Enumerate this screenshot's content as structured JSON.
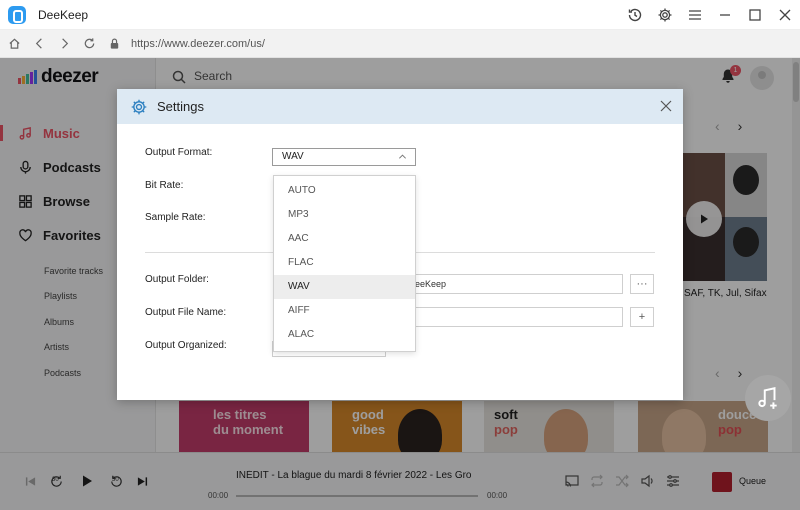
{
  "window": {
    "title": "DeeKeep",
    "url": "https://www.deezer.com/us/"
  },
  "icons": {
    "history": "history-icon",
    "settings": "gear-icon",
    "menu": "hamburger-icon",
    "minimize": "minimize-icon",
    "maximize": "maximize-icon",
    "close": "close-icon"
  },
  "brand": {
    "name": "deezer",
    "bar_colors": [
      "#ef5466",
      "#fdb43b",
      "#44c4a1",
      "#a238ff",
      "#3b83f6"
    ]
  },
  "sidebar": {
    "main": [
      {
        "label": "Music",
        "icon": "music-note-icon",
        "active": true
      },
      {
        "label": "Podcasts",
        "icon": "microphone-icon",
        "active": false
      },
      {
        "label": "Browse",
        "icon": "grid-icon",
        "active": false
      },
      {
        "label": "Favorites",
        "icon": "heart-icon",
        "active": false
      }
    ],
    "sub": [
      "Favorite tracks",
      "Playlists",
      "Albums",
      "Artists",
      "Podcasts"
    ]
  },
  "header": {
    "search_placeholder": "Search",
    "notification_count": "1"
  },
  "content": {
    "artists_caption": "SAF, TK, Jul, Sifax",
    "tiles": [
      {
        "line1": "les titres",
        "line2": "du moment",
        "bg": "#c43c6b",
        "color": "#fde3ea"
      },
      {
        "line1": "good",
        "line2": "vibes",
        "bg": "#d98a2b",
        "color": "#ffffff"
      },
      {
        "line1": "soft",
        "line2": "pop",
        "bg": "#e9e6e0",
        "color": "#222222",
        "accent": "#e0655f"
      },
      {
        "line1": "douce",
        "line2": "pop",
        "bg": "#c9a689",
        "color": "#ffffff",
        "accent": "#e24f55"
      }
    ]
  },
  "player": {
    "track": "INÉDIT - La blague du mardi 8 février 2022 - Les Gro",
    "current_time": "00:00",
    "duration": "00:00",
    "skip_back_label": "30",
    "skip_forward_label": "30",
    "queue_label": "Queue"
  },
  "dialog": {
    "title": "Settings",
    "labels": {
      "output_format": "Output Format:",
      "bit_rate": "Bit Rate:",
      "sample_rate": "Sample Rate:",
      "output_folder": "Output Folder:",
      "output_file_name": "Output File Name:",
      "output_organized": "Output Organized:"
    },
    "output_format_value": "WAV",
    "output_folder_value": "eeKeep",
    "output_file_name_value": "",
    "folder_browse_label": "···",
    "file_name_add_label": "+",
    "format_options": [
      "AUTO",
      "MP3",
      "AAC",
      "FLAC",
      "WAV",
      "AIFF",
      "ALAC"
    ],
    "selected_option": "WAV"
  },
  "colors": {
    "accent": "#ef5466",
    "dialog_header": "#dde9f3",
    "dialog_icon": "#2b7fc0"
  }
}
